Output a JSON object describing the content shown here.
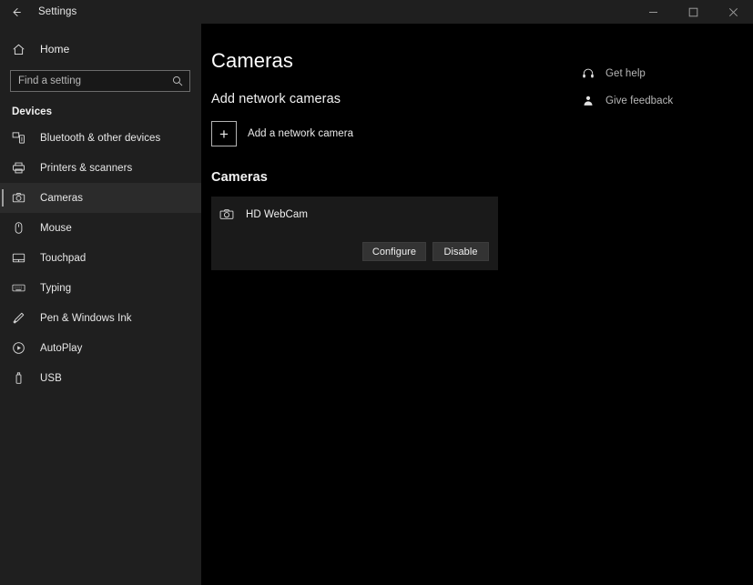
{
  "titlebar": {
    "back_icon": "back-arrow-icon",
    "app_title": "Settings",
    "minimize_label": "–",
    "maximize_label": "□",
    "close_label": "✕"
  },
  "sidebar": {
    "home": {
      "icon": "home-icon",
      "label": "Home"
    },
    "search": {
      "icon": "search-icon",
      "placeholder": "Find a setting",
      "value": ""
    },
    "section_label": "Devices",
    "items": [
      {
        "icon": "bluetooth-devices-icon",
        "label": "Bluetooth & other devices",
        "selected": false
      },
      {
        "icon": "printer-icon",
        "label": "Printers & scanners",
        "selected": false
      },
      {
        "icon": "camera-icon",
        "label": "Cameras",
        "selected": true
      },
      {
        "icon": "mouse-icon",
        "label": "Mouse",
        "selected": false
      },
      {
        "icon": "touchpad-icon",
        "label": "Touchpad",
        "selected": false
      },
      {
        "icon": "keyboard-icon",
        "label": "Typing",
        "selected": false
      },
      {
        "icon": "pen-icon",
        "label": "Pen & Windows Ink",
        "selected": false
      },
      {
        "icon": "autoplay-icon",
        "label": "AutoPlay",
        "selected": false
      },
      {
        "icon": "usb-icon",
        "label": "USB",
        "selected": false
      }
    ]
  },
  "main": {
    "page_title": "Cameras",
    "add_section": {
      "heading": "Add network cameras",
      "add_icon": "plus-icon",
      "add_label": "Add a network camera"
    },
    "cameras_section": {
      "heading": "Cameras",
      "devices": [
        {
          "icon": "camera-icon",
          "name": "HD WebCam",
          "configure_label": "Configure",
          "disable_label": "Disable"
        }
      ]
    }
  },
  "help_rail": {
    "links": [
      {
        "icon": "help-headset-icon",
        "label": "Get help"
      },
      {
        "icon": "feedback-person-icon",
        "label": "Give feedback"
      }
    ]
  },
  "colors": {
    "sidebar_bg": "#1f1f1f",
    "content_bg": "#000000",
    "card_bg": "#1a1a1a",
    "button_bg": "#333333",
    "selected_row_bg": "#2b2b2b",
    "accent_bar": "#9d9d9d",
    "text_primary": "#f0f0f0",
    "text_muted": "#b8b8b8"
  }
}
